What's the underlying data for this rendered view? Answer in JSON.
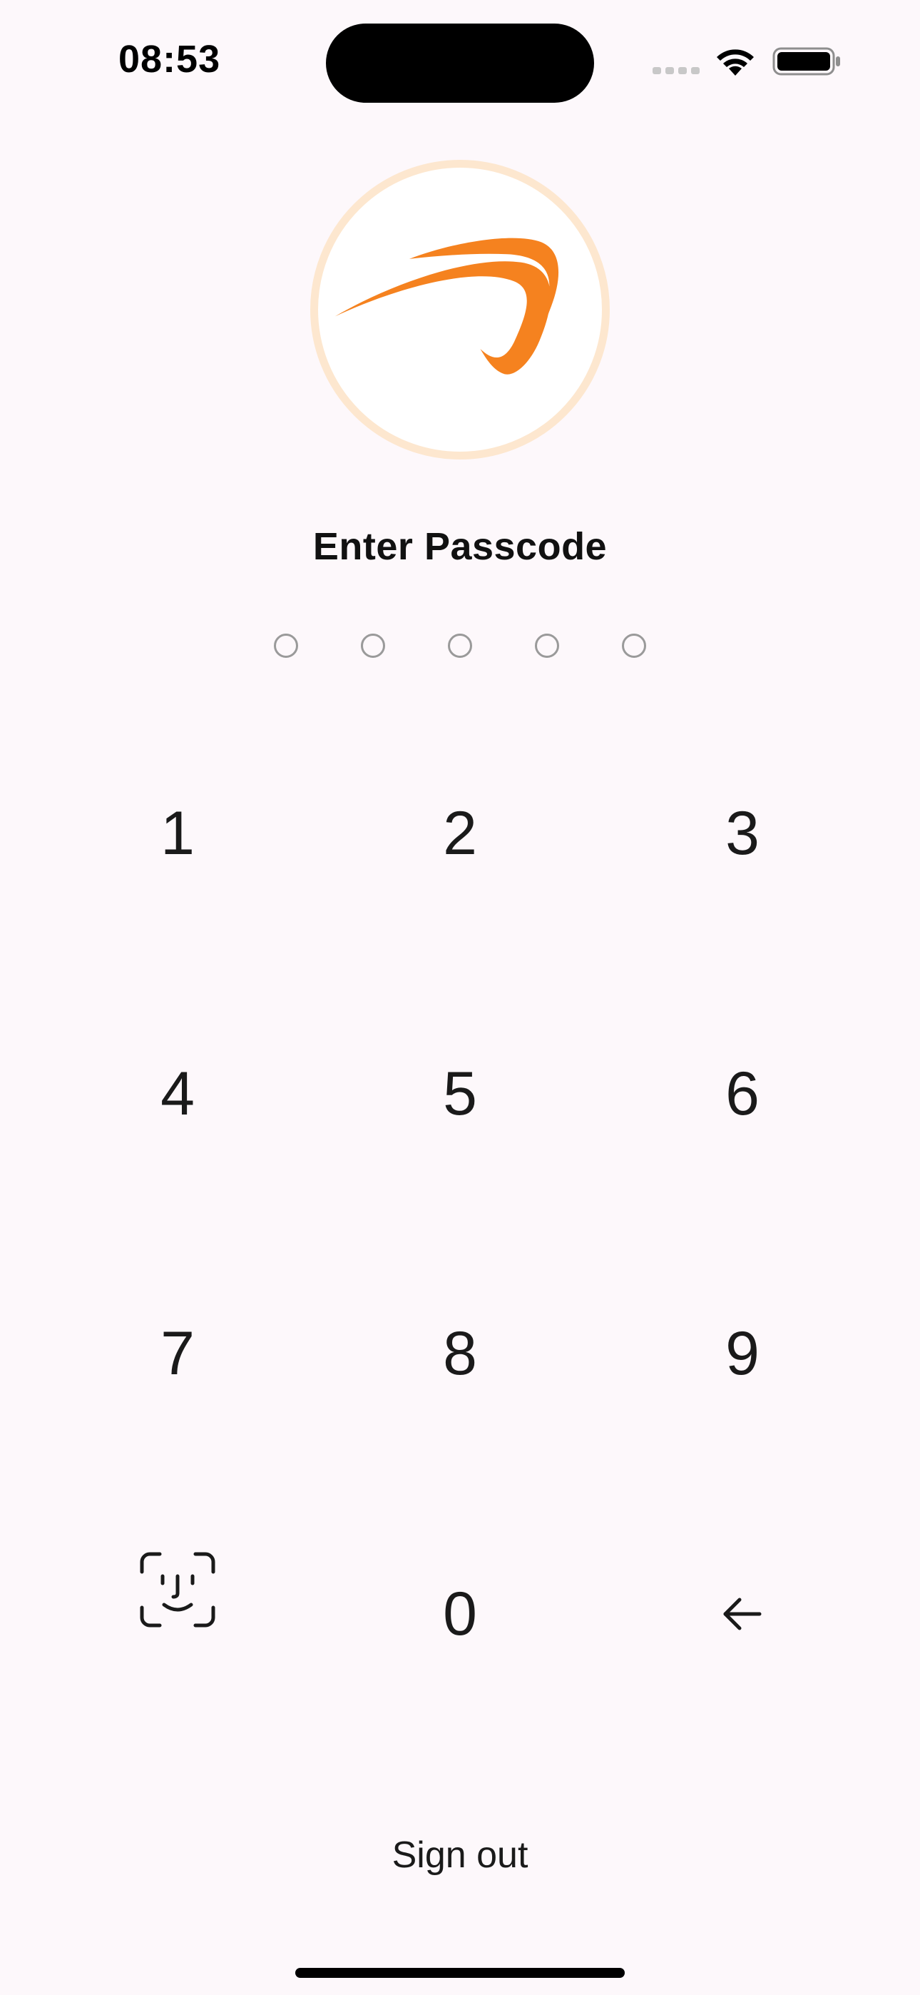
{
  "status_bar": {
    "time": "08:53",
    "icons": [
      "signal-icon",
      "wifi-icon",
      "battery-icon"
    ]
  },
  "logo": {
    "icon": "brand-swoosh-logo",
    "brand_color": "#f5821f",
    "ring_color": "#fde7cf"
  },
  "title": "Enter Passcode",
  "passcode": {
    "length": 5,
    "entered": 0
  },
  "keypad": {
    "k1": "1",
    "k2": "2",
    "k3": "3",
    "k4": "4",
    "k5": "5",
    "k6": "6",
    "k7": "7",
    "k8": "8",
    "k9": "9",
    "k0": "0",
    "face_id_icon": "face-id-icon",
    "backspace_icon": "backspace-arrow-icon"
  },
  "sign_out_label": "Sign out"
}
